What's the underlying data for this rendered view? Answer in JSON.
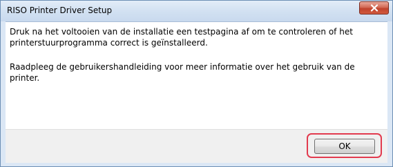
{
  "window": {
    "title": "RISO Printer Driver Setup"
  },
  "message": {
    "paragraph1": "Druk na het voltooien van de installatie een testpagina af om te controleren of het printerstuurprogramma correct is geïnstalleerd.",
    "paragraph2": "Raadpleeg de gebruikershandleiding voor meer informatie over het gebruik van de printer."
  },
  "buttons": {
    "ok_label": "OK"
  },
  "icons": {
    "close": "close-icon"
  },
  "colors": {
    "close_button": "#c0432d",
    "highlight": "#e23a4e"
  }
}
